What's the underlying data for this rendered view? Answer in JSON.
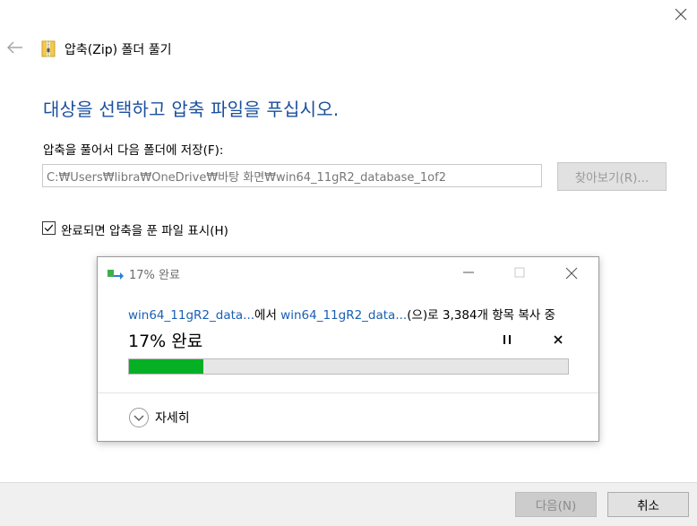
{
  "window": {
    "title": "압축(Zip) 폴더 풀기",
    "close_icon": "close-icon",
    "back_icon": "back-arrow-icon",
    "zip_icon": "zip-folder-icon"
  },
  "main": {
    "heading": "대상을 선택하고 압축 파일을 푸십시오.",
    "destination_label": "압축을 풀어서 다음 폴더에 저장(F):",
    "destination_path": "C:₩Users₩libra₩OneDrive₩바탕 화면₩win64_11gR2_database_1of2",
    "browse_label": "찾아보기(R)...",
    "show_files_checked": true,
    "show_files_label": "완료되면 압축을 푼 파일 표시(H)"
  },
  "progress": {
    "title": "17% 완료",
    "source_link": "win64_11gR2_data...",
    "from_text": "에서 ",
    "dest_link": "win64_11gR2_data...",
    "items_text": "(으)로 3,384개 항목 복사 중",
    "percent_text": "17% 완료",
    "percent": 17,
    "details_label": "자세히",
    "bar_color": "#06b025"
  },
  "footer": {
    "next_label": "다음(N)",
    "cancel_label": "취소"
  }
}
